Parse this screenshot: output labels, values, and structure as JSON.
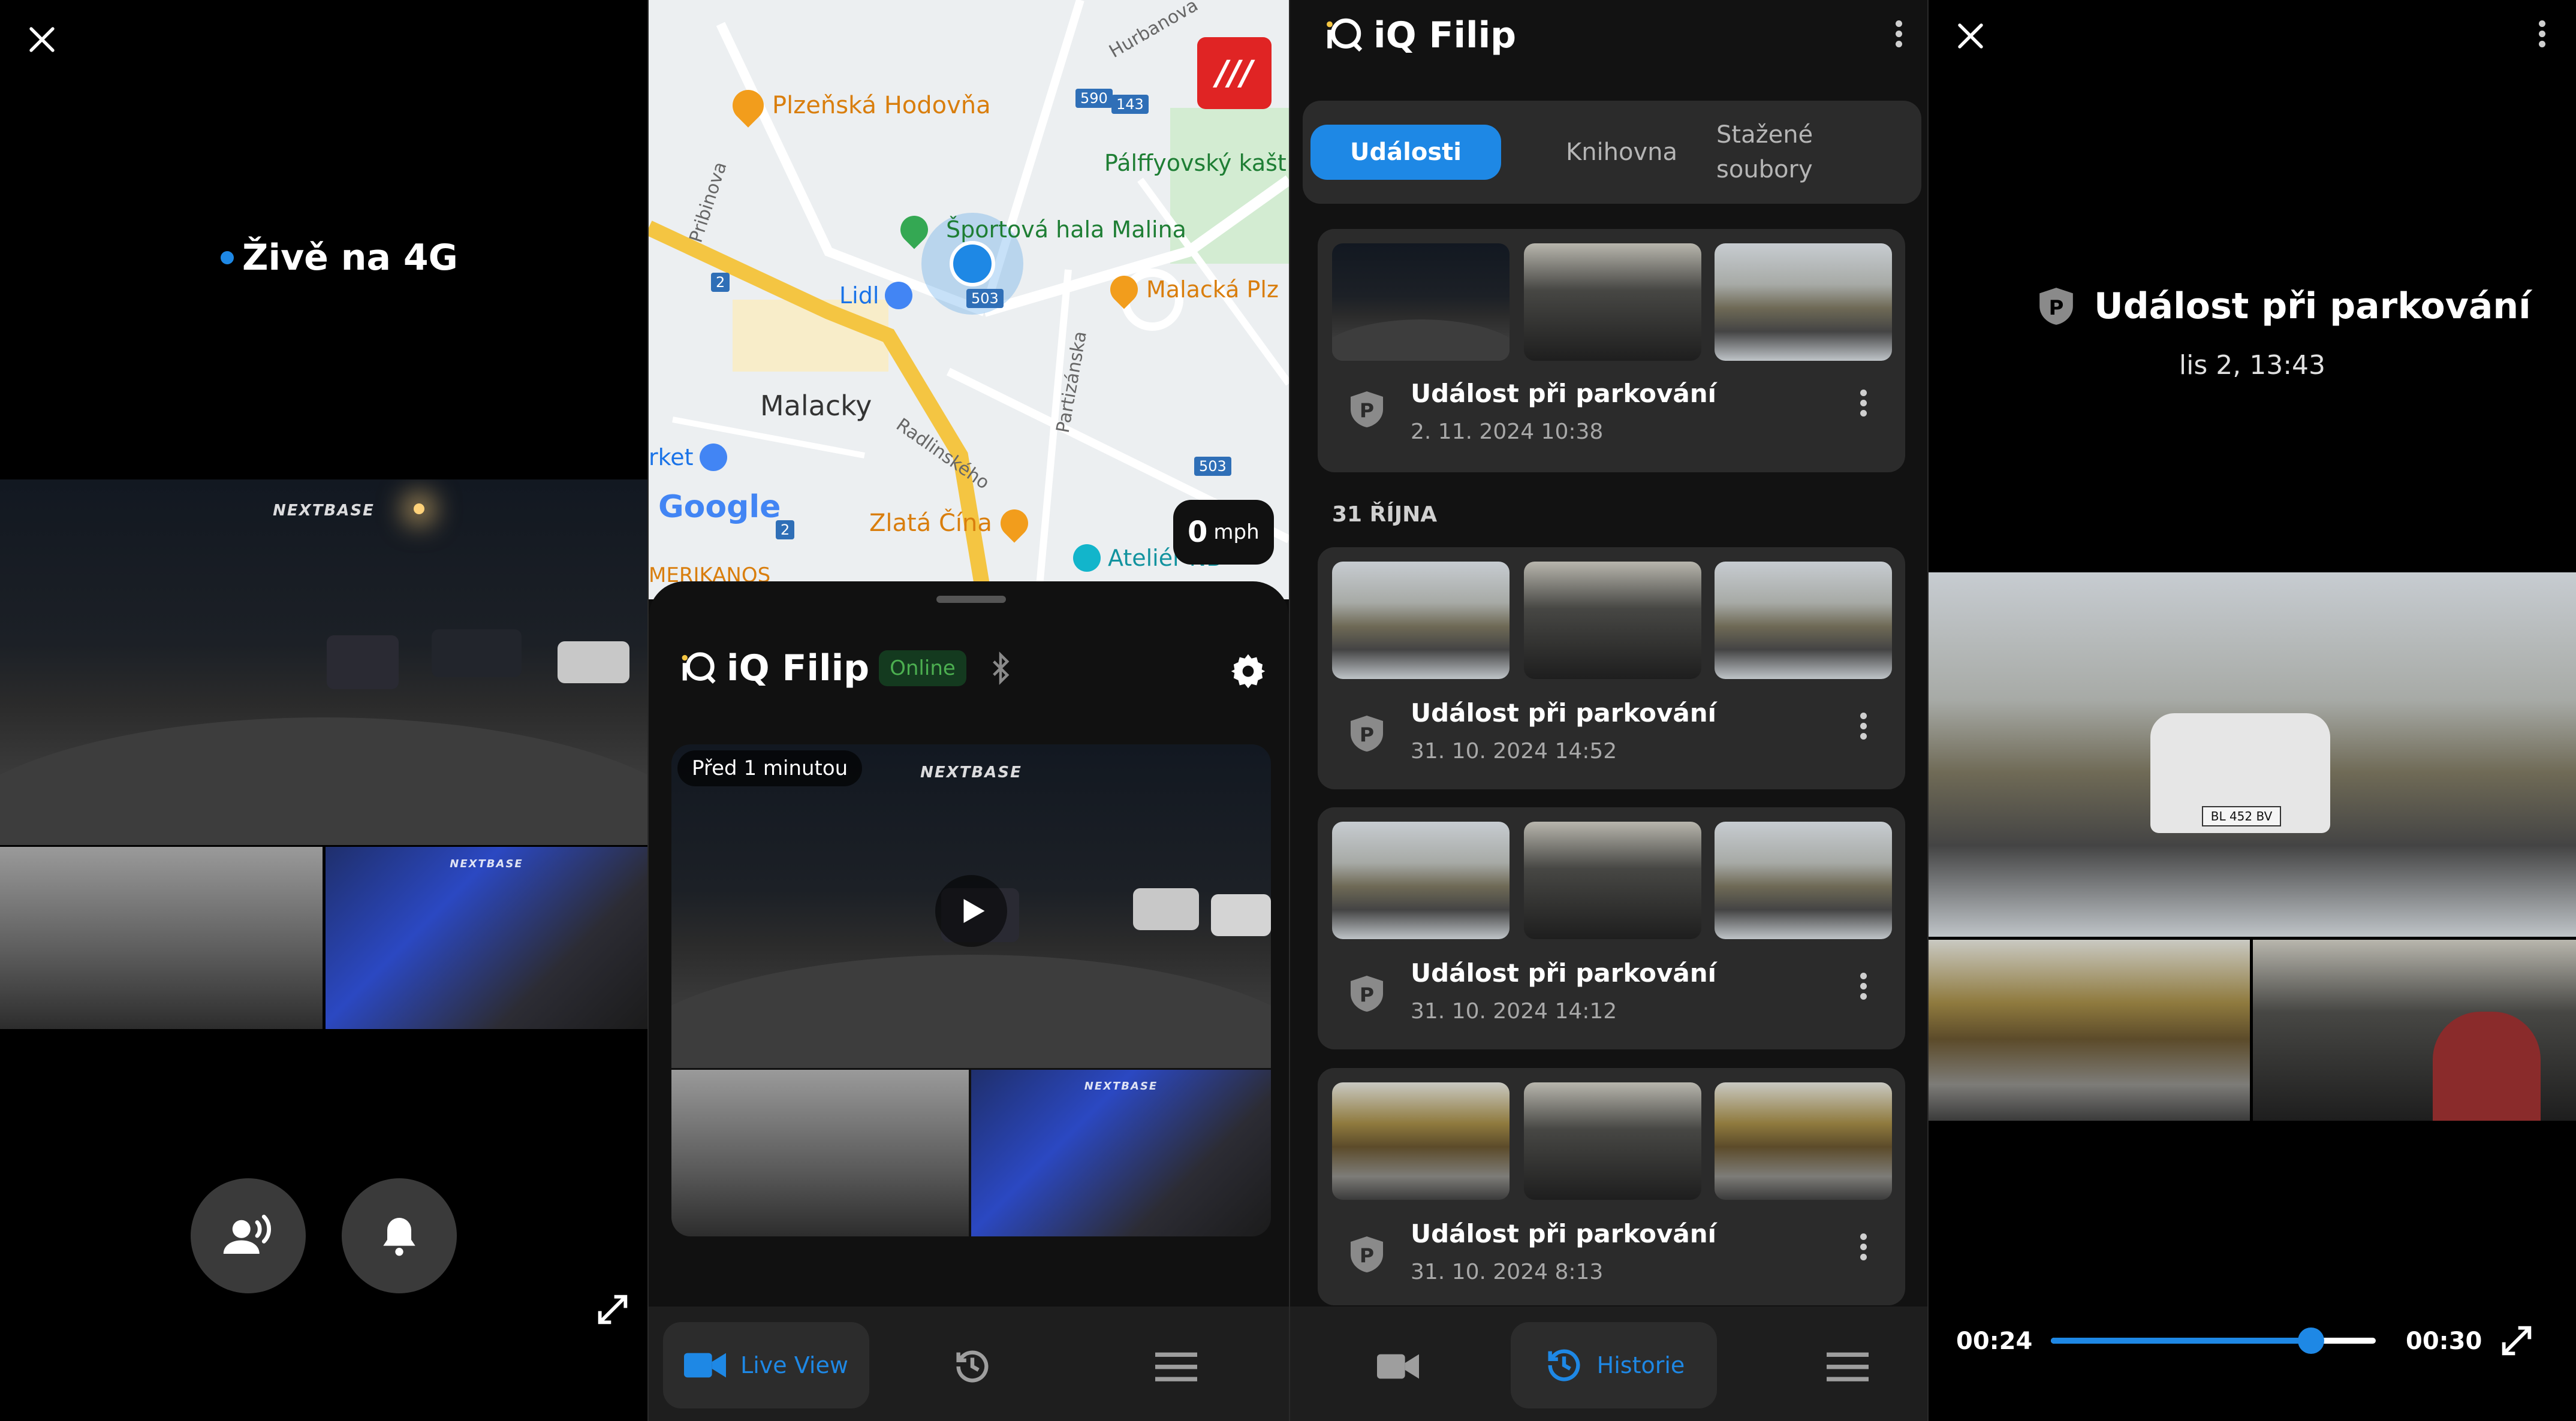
{
  "live_panel": {
    "status_text": "Živě na 4G",
    "status_dot_color": "#1e88e5",
    "watermark": "NEXTBASE"
  },
  "map_panel": {
    "labels": {
      "restaurant1": "Plzeňská Hodovňa",
      "sport_hall": "Športová hala Malina",
      "lidl": "Lidl",
      "town": "Malacky",
      "palffy": "Pálffyovský kašt",
      "restaurant2": "Malacká Plz",
      "market": "rket",
      "zlata_cina": "Zlatá Čína",
      "atelier": "Ateliér NB",
      "amerikanos": "MERIKANOS",
      "street_hurbanova": "Hurbanova",
      "street_pribinova": "Pribinova",
      "street_partizanska": "Partizánska",
      "street_radlinskeho": "Radlinského",
      "google": "Google"
    },
    "road_signs": [
      "590",
      "143",
      "2",
      "503",
      "503",
      "2"
    ],
    "speed_value": "0",
    "speed_unit": "mph",
    "logo_glyph": "///",
    "accent_color": "#e02424"
  },
  "device_panel": {
    "device_name": "iQ Filip",
    "online_badge": "Online",
    "video_timestamp": "Před 1 minutou",
    "nav": {
      "live_view": "Live View"
    }
  },
  "events_panel": {
    "device_name": "iQ Filip",
    "tabs": [
      "Události",
      "Knihovna",
      "Stažené soubory"
    ],
    "active_tab": 0,
    "section_header": "31 ŘÍJNA",
    "events": [
      {
        "title": "Událost při parkování",
        "date": "2. 11. 2024 10:38"
      },
      {
        "title": "Událost při parkování",
        "date": "31. 10. 2024 14:52"
      },
      {
        "title": "Událost při parkování",
        "date": "31. 10. 2024 14:12"
      },
      {
        "title": "Událost při parkování",
        "date": "31. 10. 2024 8:13"
      }
    ],
    "nav": {
      "history": "Historie"
    }
  },
  "player_panel": {
    "event_title": "Událost při parkování",
    "event_date": "lis 2, 13:43",
    "current_time": "00:24",
    "total_time": "00:30",
    "progress": 0.8,
    "plate_front": "BL 452 BV"
  },
  "colors": {
    "accent": "#1e88e5",
    "panel_bg": "#000000",
    "card_bg": "#2b2b2b",
    "online_green": "#4caf50"
  }
}
